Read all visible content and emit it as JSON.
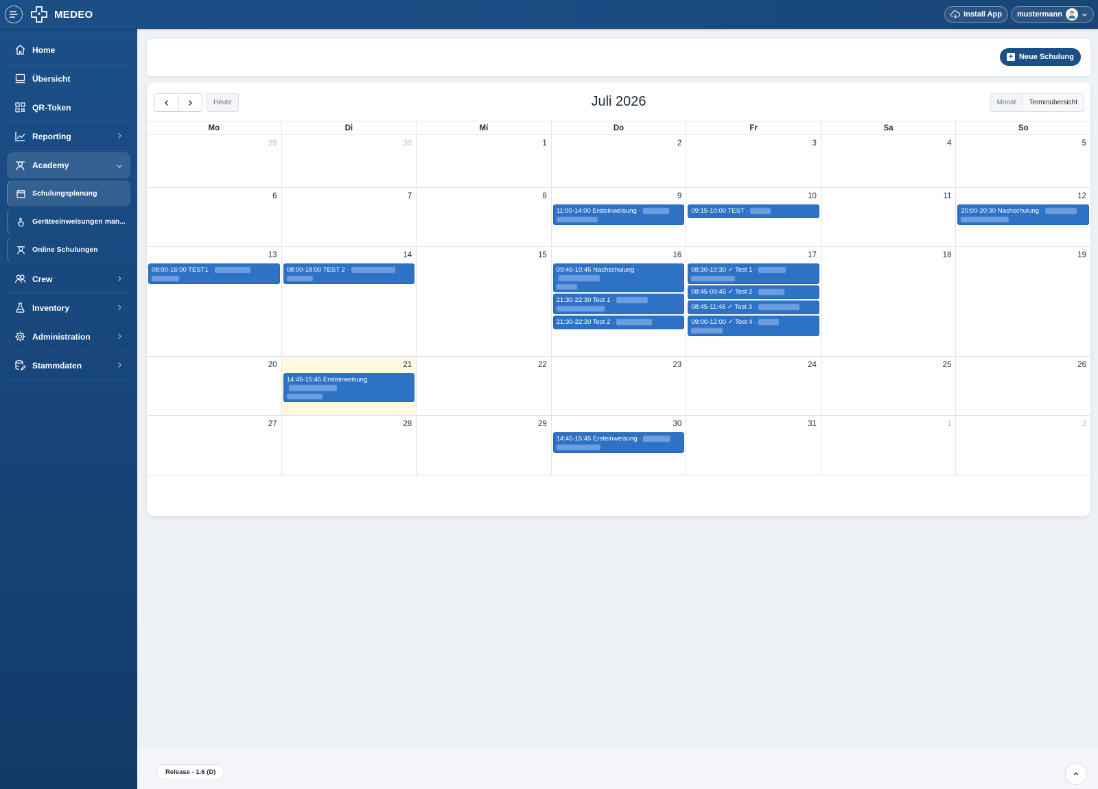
{
  "app": {
    "name": "MEDEO"
  },
  "topbar": {
    "install_label": "Install App",
    "user_name": "mustermann"
  },
  "sidebar": {
    "items": [
      {
        "label": "Home",
        "icon": "home-icon"
      },
      {
        "label": "Übersicht",
        "icon": "monitor-icon"
      },
      {
        "label": "QR-Token",
        "icon": "qr-code-icon"
      },
      {
        "label": "Reporting",
        "icon": "chart-icon"
      },
      {
        "label": "Academy",
        "icon": "academy-icon"
      },
      {
        "label": "Crew",
        "icon": "crew-icon"
      },
      {
        "label": "Inventory",
        "icon": "inventory-icon"
      },
      {
        "label": "Administration",
        "icon": "gear-icon"
      },
      {
        "label": "Stammdaten",
        "icon": "database-edit-icon"
      }
    ],
    "academy_sub": [
      {
        "label": "Schulungsplanung"
      },
      {
        "label": "Geräteeinweisungen man..."
      },
      {
        "label": "Online Schulungen"
      }
    ]
  },
  "header": {
    "new_button": "Neue Schulung"
  },
  "calendar": {
    "title": "Juli 2026",
    "today_label": "Heute",
    "view_month": "Monat",
    "view_list": "Terminübersicht",
    "weekdays": [
      "Mo",
      "Di",
      "Mi",
      "Do",
      "Fr",
      "Sa",
      "So"
    ],
    "weeks": [
      {
        "days": [
          {
            "n": "29",
            "other": true,
            "events": []
          },
          {
            "n": "30",
            "other": true,
            "events": []
          },
          {
            "n": "1",
            "events": []
          },
          {
            "n": "2",
            "events": []
          },
          {
            "n": "3",
            "events": []
          },
          {
            "n": "4",
            "events": []
          },
          {
            "n": "5",
            "events": []
          }
        ]
      },
      {
        "days": [
          {
            "n": "6",
            "events": []
          },
          {
            "n": "7",
            "events": []
          },
          {
            "n": "8",
            "events": []
          },
          {
            "n": "9",
            "events": [
              {
                "text": "11:00-14:00 Ersteinweisung ·",
                "two": true
              }
            ]
          },
          {
            "n": "10",
            "events": [
              {
                "text": "09:15-10:00 TEST ·",
                "two": false
              }
            ]
          },
          {
            "n": "11",
            "events": []
          },
          {
            "n": "12",
            "events": [
              {
                "text": "20:00-20:30 Nachschulung ·",
                "two": true
              }
            ]
          }
        ]
      },
      {
        "days": [
          {
            "n": "13",
            "events": [
              {
                "text": "08:00-16:00 TEST1 ·",
                "two": true
              }
            ]
          },
          {
            "n": "14",
            "events": [
              {
                "text": "08:00-18:00 TEST 2 ·",
                "two": true
              }
            ]
          },
          {
            "n": "15",
            "events": []
          },
          {
            "n": "16",
            "events": [
              {
                "text": "09:45-10:45 Nachschulung ·",
                "two": true
              },
              {
                "text": "21:30-22:30 Test 1 ·",
                "two": true
              },
              {
                "text": "21:30-22:30 Test 2 ·",
                "two": false
              }
            ]
          },
          {
            "n": "17",
            "events": [
              {
                "text": "08:30-10:30 ✓ Test 1 ·",
                "two": true
              },
              {
                "text": "08:45-09:45 ✓ Test 2 ·",
                "two": false
              },
              {
                "text": "08:45-11:45 ✓ Test 3 ·",
                "two": false
              },
              {
                "text": "09:00-12:00 ✓ Test 4 ·",
                "two": true
              }
            ]
          },
          {
            "n": "18",
            "events": []
          },
          {
            "n": "19",
            "events": []
          }
        ]
      },
      {
        "days": [
          {
            "n": "20",
            "events": []
          },
          {
            "n": "21",
            "today": true,
            "events": [
              {
                "text": "14:45-15:45 Ersteinweisung ·",
                "two": true
              }
            ]
          },
          {
            "n": "22",
            "events": []
          },
          {
            "n": "23",
            "events": []
          },
          {
            "n": "24",
            "events": []
          },
          {
            "n": "25",
            "events": []
          },
          {
            "n": "26",
            "events": []
          }
        ]
      },
      {
        "days": [
          {
            "n": "27",
            "events": []
          },
          {
            "n": "28",
            "events": []
          },
          {
            "n": "29",
            "events": []
          },
          {
            "n": "30",
            "events": [
              {
                "text": "14:45-15:45 Ersteinweisung ·",
                "two": true
              }
            ]
          },
          {
            "n": "31",
            "events": []
          },
          {
            "n": "1",
            "other": true,
            "events": []
          },
          {
            "n": "2",
            "other": true,
            "events": []
          }
        ]
      }
    ]
  },
  "footer": {
    "release": "Release - 1.6 (D)"
  },
  "colors": {
    "brand": "#1b4f88",
    "event": "#2e72c6",
    "today": "#fdf8e1"
  }
}
